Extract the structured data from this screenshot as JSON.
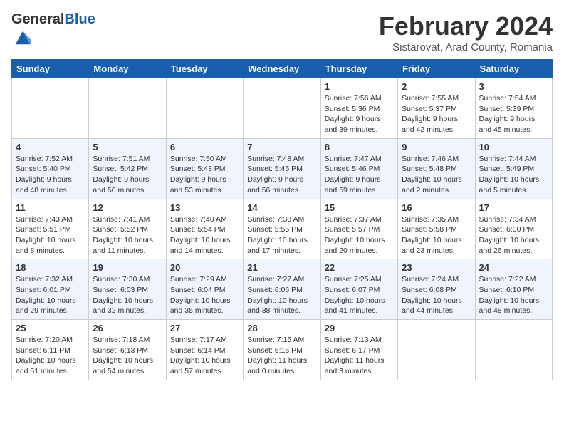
{
  "header": {
    "logo_general": "General",
    "logo_blue": "Blue",
    "month_title": "February 2024",
    "location": "Sistarovat, Arad County, Romania"
  },
  "days_of_week": [
    "Sunday",
    "Monday",
    "Tuesday",
    "Wednesday",
    "Thursday",
    "Friday",
    "Saturday"
  ],
  "weeks": [
    [
      {
        "day": "",
        "info": ""
      },
      {
        "day": "",
        "info": ""
      },
      {
        "day": "",
        "info": ""
      },
      {
        "day": "",
        "info": ""
      },
      {
        "day": "1",
        "info": "Sunrise: 7:56 AM\nSunset: 5:36 PM\nDaylight: 9 hours\nand 39 minutes."
      },
      {
        "day": "2",
        "info": "Sunrise: 7:55 AM\nSunset: 5:37 PM\nDaylight: 9 hours\nand 42 minutes."
      },
      {
        "day": "3",
        "info": "Sunrise: 7:54 AM\nSunset: 5:39 PM\nDaylight: 9 hours\nand 45 minutes."
      }
    ],
    [
      {
        "day": "4",
        "info": "Sunrise: 7:52 AM\nSunset: 5:40 PM\nDaylight: 9 hours\nand 48 minutes."
      },
      {
        "day": "5",
        "info": "Sunrise: 7:51 AM\nSunset: 5:42 PM\nDaylight: 9 hours\nand 50 minutes."
      },
      {
        "day": "6",
        "info": "Sunrise: 7:50 AM\nSunset: 5:43 PM\nDaylight: 9 hours\nand 53 minutes."
      },
      {
        "day": "7",
        "info": "Sunrise: 7:48 AM\nSunset: 5:45 PM\nDaylight: 9 hours\nand 56 minutes."
      },
      {
        "day": "8",
        "info": "Sunrise: 7:47 AM\nSunset: 5:46 PM\nDaylight: 9 hours\nand 59 minutes."
      },
      {
        "day": "9",
        "info": "Sunrise: 7:46 AM\nSunset: 5:48 PM\nDaylight: 10 hours\nand 2 minutes."
      },
      {
        "day": "10",
        "info": "Sunrise: 7:44 AM\nSunset: 5:49 PM\nDaylight: 10 hours\nand 5 minutes."
      }
    ],
    [
      {
        "day": "11",
        "info": "Sunrise: 7:43 AM\nSunset: 5:51 PM\nDaylight: 10 hours\nand 8 minutes."
      },
      {
        "day": "12",
        "info": "Sunrise: 7:41 AM\nSunset: 5:52 PM\nDaylight: 10 hours\nand 11 minutes."
      },
      {
        "day": "13",
        "info": "Sunrise: 7:40 AM\nSunset: 5:54 PM\nDaylight: 10 hours\nand 14 minutes."
      },
      {
        "day": "14",
        "info": "Sunrise: 7:38 AM\nSunset: 5:55 PM\nDaylight: 10 hours\nand 17 minutes."
      },
      {
        "day": "15",
        "info": "Sunrise: 7:37 AM\nSunset: 5:57 PM\nDaylight: 10 hours\nand 20 minutes."
      },
      {
        "day": "16",
        "info": "Sunrise: 7:35 AM\nSunset: 5:58 PM\nDaylight: 10 hours\nand 23 minutes."
      },
      {
        "day": "17",
        "info": "Sunrise: 7:34 AM\nSunset: 6:00 PM\nDaylight: 10 hours\nand 26 minutes."
      }
    ],
    [
      {
        "day": "18",
        "info": "Sunrise: 7:32 AM\nSunset: 6:01 PM\nDaylight: 10 hours\nand 29 minutes."
      },
      {
        "day": "19",
        "info": "Sunrise: 7:30 AM\nSunset: 6:03 PM\nDaylight: 10 hours\nand 32 minutes."
      },
      {
        "day": "20",
        "info": "Sunrise: 7:29 AM\nSunset: 6:04 PM\nDaylight: 10 hours\nand 35 minutes."
      },
      {
        "day": "21",
        "info": "Sunrise: 7:27 AM\nSunset: 6:06 PM\nDaylight: 10 hours\nand 38 minutes."
      },
      {
        "day": "22",
        "info": "Sunrise: 7:25 AM\nSunset: 6:07 PM\nDaylight: 10 hours\nand 41 minutes."
      },
      {
        "day": "23",
        "info": "Sunrise: 7:24 AM\nSunset: 6:08 PM\nDaylight: 10 hours\nand 44 minutes."
      },
      {
        "day": "24",
        "info": "Sunrise: 7:22 AM\nSunset: 6:10 PM\nDaylight: 10 hours\nand 48 minutes."
      }
    ],
    [
      {
        "day": "25",
        "info": "Sunrise: 7:20 AM\nSunset: 6:11 PM\nDaylight: 10 hours\nand 51 minutes."
      },
      {
        "day": "26",
        "info": "Sunrise: 7:18 AM\nSunset: 6:13 PM\nDaylight: 10 hours\nand 54 minutes."
      },
      {
        "day": "27",
        "info": "Sunrise: 7:17 AM\nSunset: 6:14 PM\nDaylight: 10 hours\nand 57 minutes."
      },
      {
        "day": "28",
        "info": "Sunrise: 7:15 AM\nSunset: 6:16 PM\nDaylight: 11 hours\nand 0 minutes."
      },
      {
        "day": "29",
        "info": "Sunrise: 7:13 AM\nSunset: 6:17 PM\nDaylight: 11 hours\nand 3 minutes."
      },
      {
        "day": "",
        "info": ""
      },
      {
        "day": "",
        "info": ""
      }
    ]
  ]
}
